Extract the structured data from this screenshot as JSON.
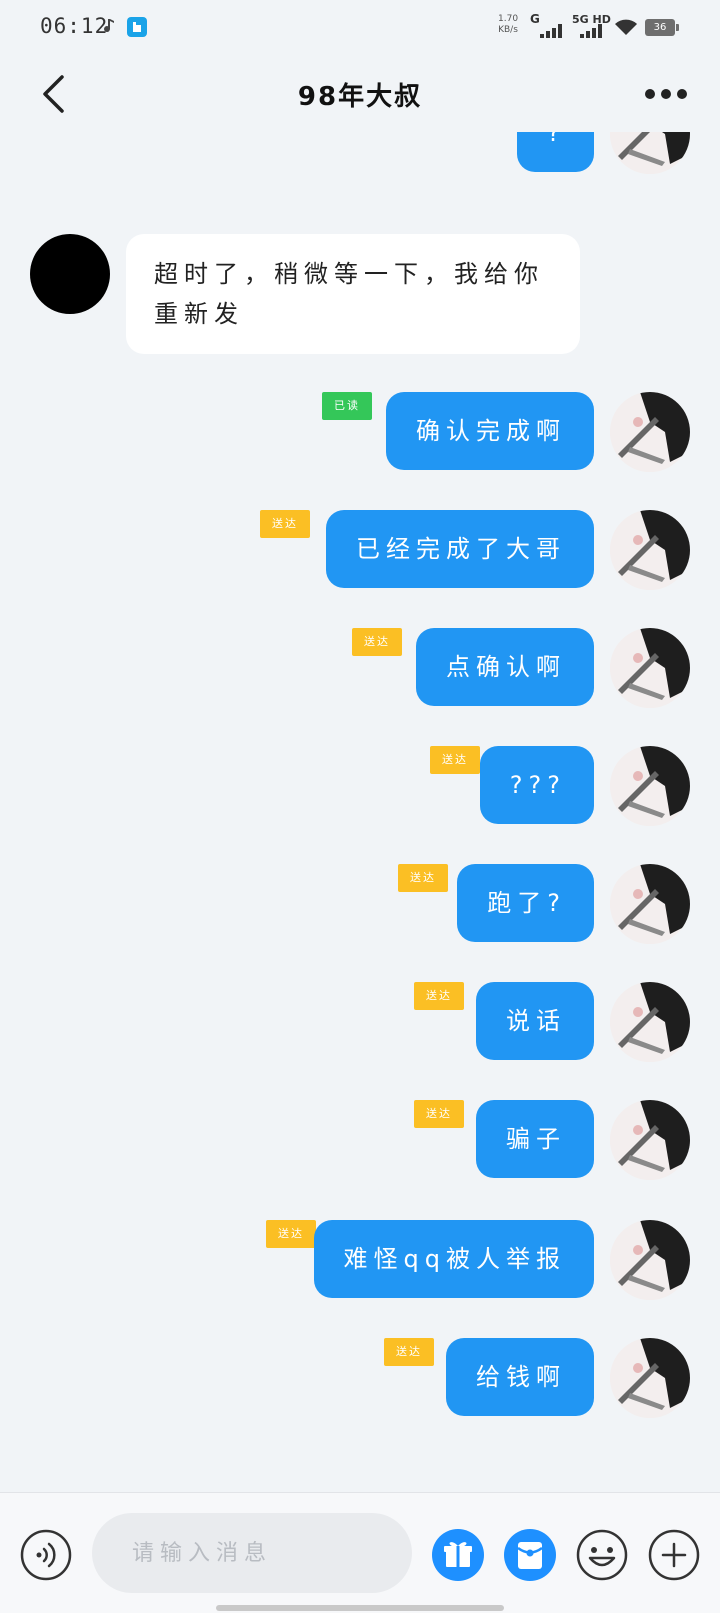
{
  "status_bar": {
    "time": "06:12",
    "net_speed_value": "1.70",
    "net_speed_unit": "KB/s",
    "network_g": "G",
    "network_5g": "5G HD",
    "battery": "36"
  },
  "header": {
    "title": "98年大叔"
  },
  "messages": [
    {
      "side": "me",
      "text": "?",
      "status": ""
    },
    {
      "side": "other",
      "text": "超时了，稍微等一下，我给你重新发"
    },
    {
      "side": "me",
      "text": "确认完成啊",
      "status": "已读"
    },
    {
      "side": "me",
      "text": "已经完成了大哥",
      "status": "送达"
    },
    {
      "side": "me",
      "text": "点确认啊",
      "status": "送达"
    },
    {
      "side": "me",
      "text": "???",
      "status": "送达"
    },
    {
      "side": "me",
      "text": "跑了?",
      "status": "送达"
    },
    {
      "side": "me",
      "text": "说话",
      "status": "送达"
    },
    {
      "side": "me",
      "text": "骗子",
      "status": "送达"
    },
    {
      "side": "me",
      "text": "难怪qq被人举报",
      "status": "送达"
    },
    {
      "side": "me",
      "text": "给钱啊",
      "status": "送达"
    }
  ],
  "input": {
    "placeholder": "请输入消息"
  },
  "colors": {
    "my_bubble": "#2196f3",
    "other_bubble": "#ffffff",
    "read_badge": "#34c759",
    "sent_badge": "#fbbf24",
    "background": "#f1f4f7"
  },
  "icons": {
    "back": "chevron-left-icon",
    "more": "more-dots-icon",
    "voice": "voice-icon",
    "gift": "gift-icon",
    "red_packet": "red-packet-icon",
    "emoji": "emoji-icon",
    "plus": "plus-icon"
  }
}
